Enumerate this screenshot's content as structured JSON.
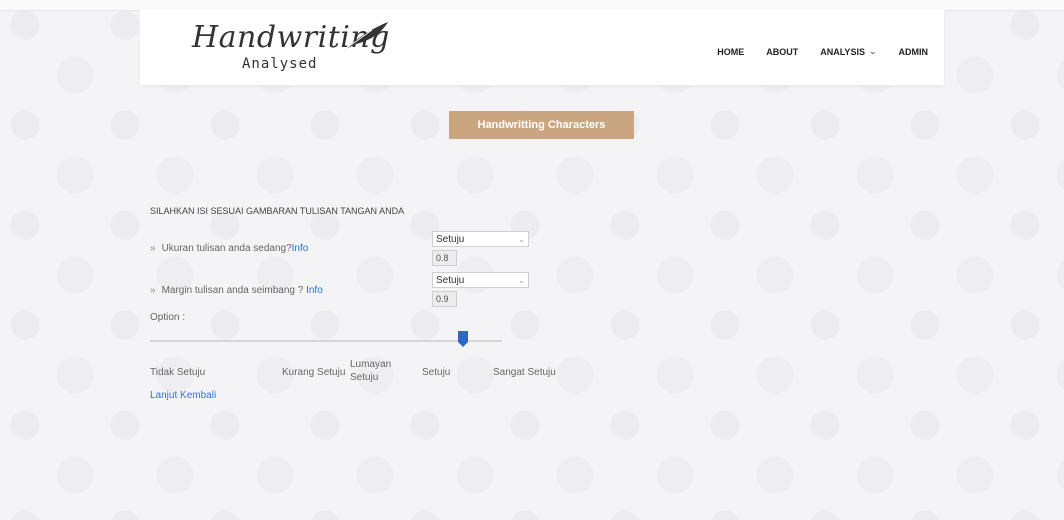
{
  "header": {
    "logo_script": "Handwriting",
    "logo_sub": "Analysed",
    "nav": [
      "HOME",
      "ABOUT",
      "ANALYSIS",
      "ADMIN"
    ]
  },
  "main": {
    "title_button": "Handwritting Characters",
    "instruction": "SILAHKAN ISI SESUAI GAMBARAN TULISAN TANGAN ANDA",
    "questions": [
      {
        "text": "Ukuran tulisan anda sedang?",
        "info": "Info",
        "selected": "Setuju",
        "value": "0.8"
      },
      {
        "text": "Margin tulisan anda seimbang ? ",
        "info": "Info",
        "selected": "Setuju",
        "value": "0.9"
      }
    ],
    "option_label": "Option :",
    "slider": {
      "level": 0.89
    },
    "scale": [
      "Tidak Setuju",
      "Kurang Setuju",
      "Lumayan Setuju",
      "Setuju",
      "Sangat Setuju"
    ],
    "links": {
      "next": "Lanjut",
      "back": "Kembali"
    }
  },
  "colors": {
    "accent": "#c9a680",
    "link": "#1a73e8",
    "thumb": "#2f64c8"
  }
}
